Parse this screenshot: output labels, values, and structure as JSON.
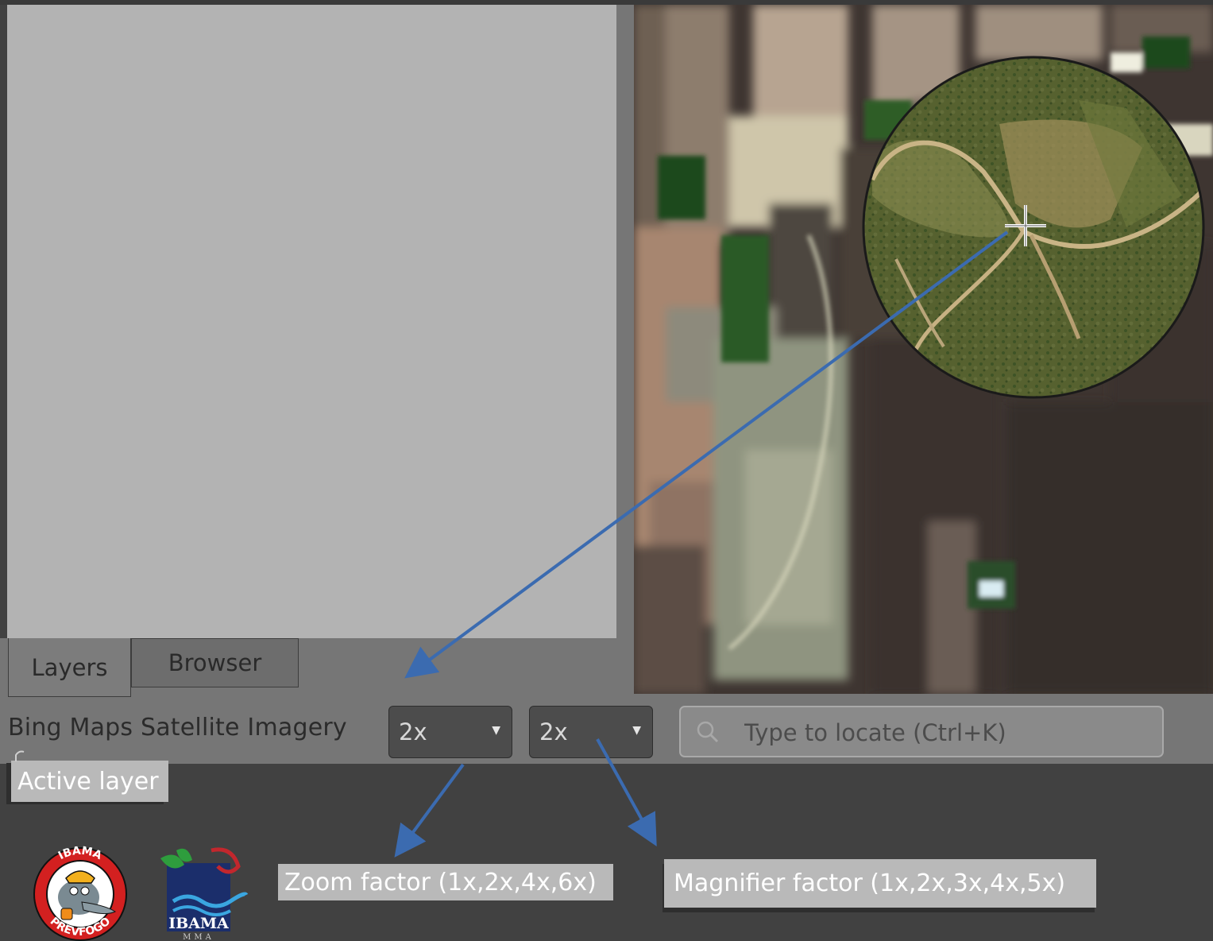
{
  "tabs": [
    {
      "label": "Layers",
      "active": true
    },
    {
      "label": "Browser",
      "active": false
    }
  ],
  "status_bar": {
    "layer_name": "Bing Maps Satellite Imagery",
    "zoom_combo": {
      "value": "2x"
    },
    "magnifier_combo": {
      "value": "2x"
    },
    "locator": {
      "placeholder": "Type to locate (Ctrl+K)",
      "value": ""
    }
  },
  "callouts": {
    "active_layer": "Active layer",
    "zoom_factor": "Zoom factor (1x,2x,4x,6x)",
    "magnifier_factor": "Magnifier factor (1x,2x,3x,4x,5x)"
  },
  "logos": {
    "prevfogo": {
      "top_text": "IBAMA",
      "bottom_text": "PREVFOGO"
    },
    "ibama": {
      "text": "IBAMA",
      "subtext": "MMA"
    }
  },
  "colors": {
    "background": "#414141",
    "panel": "#b3b3b3",
    "callout_arrow": "#3b6bb0",
    "callout_label": "#b9b9b9",
    "combo": "#4c4c4c"
  },
  "icons": {
    "locator": "search-icon",
    "combo_arrow": "chevron-down-icon",
    "map_cursor": "crosshair-icon"
  }
}
